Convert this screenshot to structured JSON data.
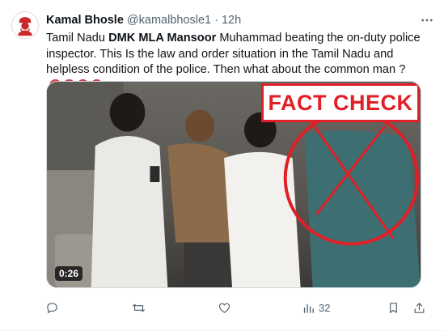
{
  "tweet": {
    "author_name": "Kamal Bhosle",
    "handle": "@kamalbhosle1",
    "separator": "·",
    "time": "12h",
    "text_part1": "Tamil Nadu ",
    "text_bold": "DMK MLA Mansoor",
    "text_part2": " Muhammad beating the on-duty police inspector. This Is the law and order situation in the Tamil Nadu and helpless condition of the police. Then what about the common man ?",
    "emojis": [
      "angry-face",
      "angry-face",
      "angry-face",
      "angry-face"
    ]
  },
  "media": {
    "overlay_label": "FACT CHECK",
    "duration": "0:26",
    "overlay_color": "#e01f26"
  },
  "actions": {
    "reply_icon": "reply-icon",
    "retweet_icon": "retweet-icon",
    "like_icon": "heart-icon",
    "views_icon": "views-chart-icon",
    "views_count": "32",
    "bookmark_icon": "bookmark-icon",
    "share_icon": "share-icon"
  },
  "colors": {
    "text": "#0f1419",
    "secondary": "#536471",
    "accent_red": "#e01f26"
  }
}
